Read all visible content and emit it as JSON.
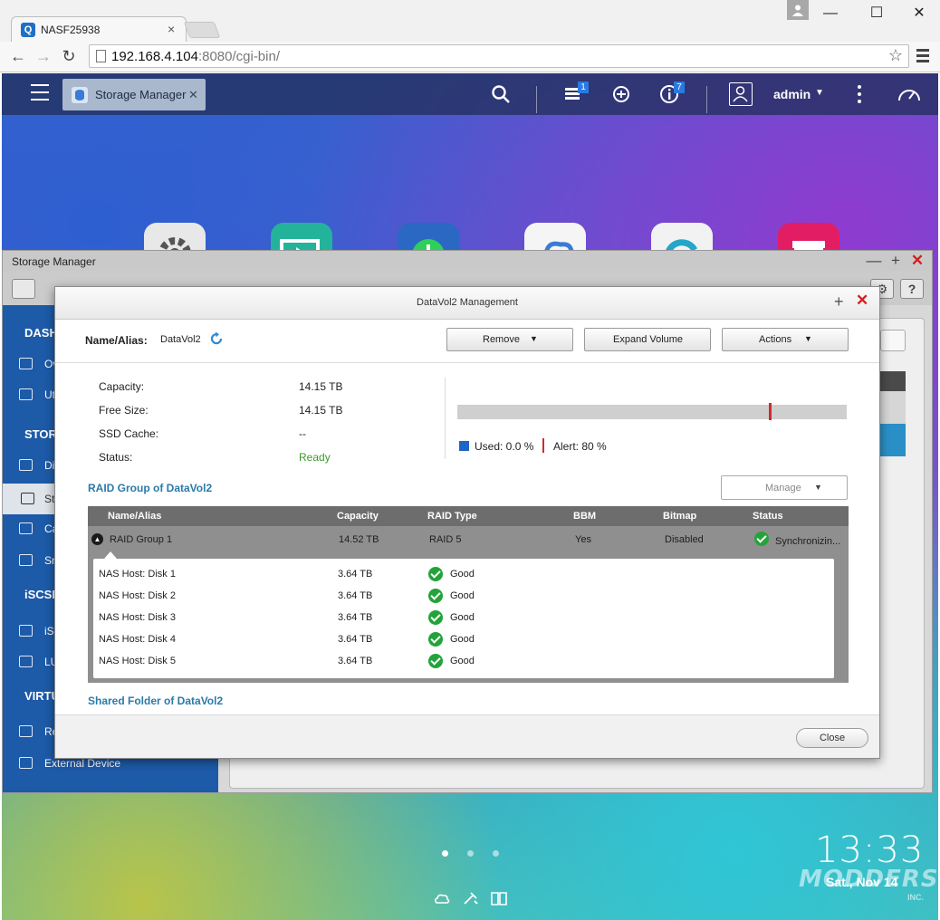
{
  "browser": {
    "tab_title": "NASF25938",
    "favicon_letter": "Q",
    "url_host": "192.168.4.104",
    "url_rest": ":8080/cgi-bin/"
  },
  "qts_bar": {
    "app_tab_label": "Storage Manager",
    "notifications_badge": "1",
    "events_badge": "7",
    "user": "admin"
  },
  "storage_manager": {
    "title": "Storage Manager",
    "sidebar": {
      "heading_1": "DASH",
      "item_1": "Ov",
      "item_2": "Ut",
      "heading_2": "STOR",
      "item_3": "Di",
      "item_4": "St",
      "item_5": "Ca",
      "item_6": "Sn",
      "heading_3": "iSCSI",
      "item_7": "iS",
      "item_8": "LU",
      "heading_4": "VIRTU",
      "item_9": "Re",
      "item_10": "External Device"
    }
  },
  "dialog": {
    "title": "DataVol2 Management",
    "name_label": "Name/Alias:",
    "name_value": "DataVol2",
    "buttons": {
      "remove": "Remove",
      "expand": "Expand Volume",
      "actions": "Actions",
      "manage": "Manage",
      "close": "Close"
    },
    "info": {
      "capacity_label": "Capacity:",
      "capacity_value": "14.15 TB",
      "free_label": "Free Size:",
      "free_value": "14.15 TB",
      "ssd_label": "SSD Cache:",
      "ssd_value": "--",
      "status_label": "Status:",
      "status_value": "Ready"
    },
    "usage": {
      "used_fraction": 0.0,
      "alert_fraction": 0.8,
      "used_label": "Used: 0.0 %",
      "alert_label": "Alert: 80 %"
    },
    "raid_heading": "RAID Group of DataVol2",
    "raid_columns": [
      "Name/Alias",
      "Capacity",
      "RAID Type",
      "BBM",
      "Bitmap",
      "Status"
    ],
    "raid_group": {
      "name": "RAID Group 1",
      "capacity": "14.52 TB",
      "raid_type": "RAID 5",
      "bbm": "Yes",
      "bitmap": "Disabled",
      "status": "Synchronizin..."
    },
    "disks": [
      {
        "name": "NAS Host: Disk 1",
        "capacity": "3.64 TB",
        "status": "Good"
      },
      {
        "name": "NAS Host: Disk 2",
        "capacity": "3.64 TB",
        "status": "Good"
      },
      {
        "name": "NAS Host: Disk 3",
        "capacity": "3.64 TB",
        "status": "Good"
      },
      {
        "name": "NAS Host: Disk 4",
        "capacity": "3.64 TB",
        "status": "Good"
      },
      {
        "name": "NAS Host: Disk 5",
        "capacity": "3.64 TB",
        "status": "Good"
      }
    ],
    "shared_heading": "Shared Folder of DataVol2"
  },
  "desktop": {
    "time": "13:33",
    "date": "Sat., Nov 14",
    "watermark": "MODDERS",
    "watermark_sub": "INC."
  },
  "colors": {
    "accent_blue": "#1f65c8",
    "alert_red": "#cf2b2b",
    "good_green": "#23a33a",
    "heading_teal": "#2a7aaa"
  }
}
